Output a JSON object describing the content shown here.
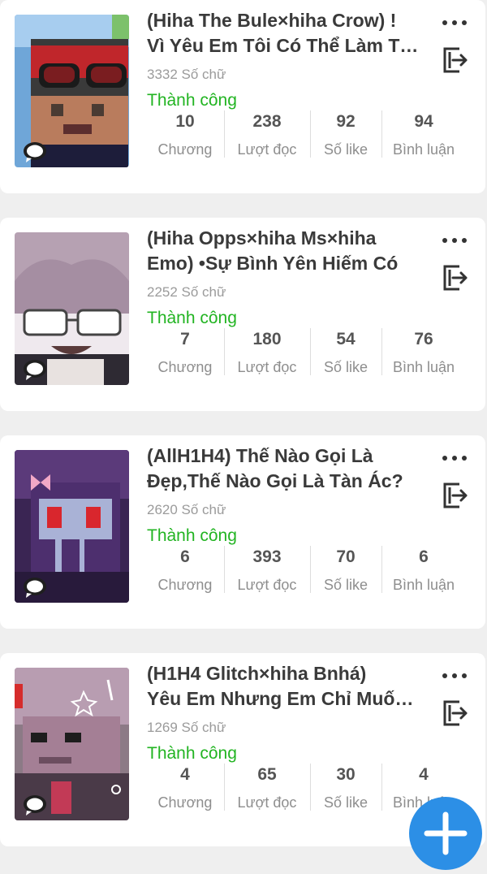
{
  "stories": [
    {
      "title_line1": "(Hiha The Bule×hiha Crow) !",
      "title_line2": "Vì Yêu Em Tôi Có Thể Làm Tất Cả",
      "word_count": "3332 Số chữ",
      "status": "Thành công",
      "stats": [
        {
          "value": "10",
          "label": "Chương"
        },
        {
          "value": "238",
          "label": "Lượt đọc"
        },
        {
          "value": "92",
          "label": "Số like"
        },
        {
          "value": "94",
          "label": "Bình luận"
        }
      ]
    },
    {
      "title_line1": "(Hiha Opps×hiha Ms×hiha",
      "title_line2": "Emo) •Sự Bình Yên Hiếm Có",
      "word_count": "2252 Số chữ",
      "status": "Thành công",
      "stats": [
        {
          "value": "7",
          "label": "Chương"
        },
        {
          "value": "180",
          "label": "Lượt đọc"
        },
        {
          "value": "54",
          "label": "Số like"
        },
        {
          "value": "76",
          "label": "Bình luận"
        }
      ]
    },
    {
      "title_line1": "(AllH1H4) Thế Nào Gọi Là",
      "title_line2": "Đẹp,Thế Nào Gọi Là Tàn Ác?",
      "word_count": "2620 Số chữ",
      "status": "Thành công",
      "stats": [
        {
          "value": "6",
          "label": "Chương"
        },
        {
          "value": "393",
          "label": "Lượt đọc"
        },
        {
          "value": "70",
          "label": "Số like"
        },
        {
          "value": "6",
          "label": "Bình luận"
        }
      ]
    },
    {
      "title_line1": "(H1H4 Glitch×hiha Bnhá)",
      "title_line2": "Yêu Em Nhưng Em Chỉ Muốn Trốn",
      "word_count": "1269 Số chữ",
      "status": "Thành công",
      "stats": [
        {
          "value": "4",
          "label": "Chương"
        },
        {
          "value": "65",
          "label": "Lượt đọc"
        },
        {
          "value": "30",
          "label": "Số like"
        },
        {
          "value": "4",
          "label": "Bình luận"
        }
      ]
    }
  ],
  "icons": {
    "more": "more-icon",
    "export": "export-icon",
    "comment": "comment-bubble-icon",
    "add": "plus-icon"
  },
  "colors": {
    "status_green": "#22b422",
    "fab_blue": "#2c8fe6"
  }
}
